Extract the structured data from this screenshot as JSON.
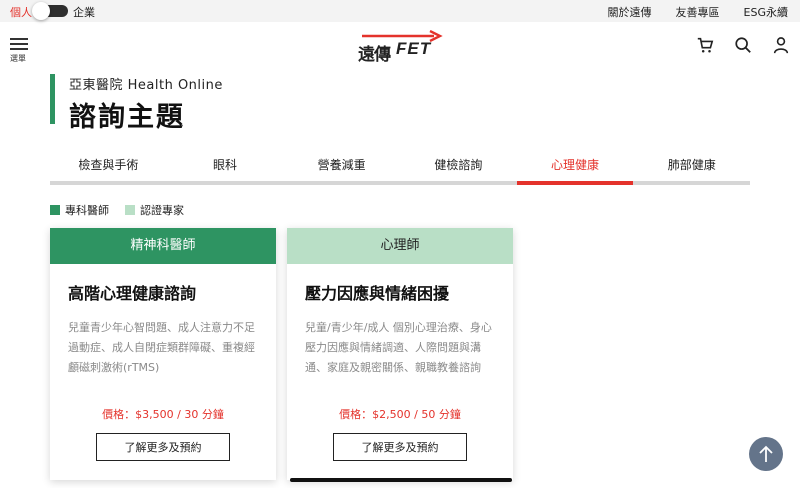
{
  "topbar": {
    "persona_personal": "個人",
    "persona_business": "企業",
    "links": [
      "關於遠傳",
      "友善專區",
      "ESG永續"
    ]
  },
  "header": {
    "menu_label": "選單",
    "logo_chinese": "遠傳",
    "logo_latin": "FET",
    "icons": [
      "cart-icon",
      "search-icon",
      "user-icon"
    ]
  },
  "section": {
    "subtitle": "亞東醫院 Health Online",
    "title": "諮詢主題"
  },
  "tabs": [
    {
      "label": "檢查與手術",
      "active": false
    },
    {
      "label": "眼科",
      "active": false
    },
    {
      "label": "營養減重",
      "active": false
    },
    {
      "label": "健檢諮詢",
      "active": false
    },
    {
      "label": "心理健康",
      "active": true
    },
    {
      "label": "肺部健康",
      "active": false
    }
  ],
  "legend": [
    {
      "label": "專科醫師",
      "color": "#2e9462"
    },
    {
      "label": "認證專家",
      "color": "#b9dfc6"
    }
  ],
  "cards": [
    {
      "category": "精神科醫師",
      "title": "高階心理健康諮詢",
      "description": "兒童青少年心智問題、成人注意力不足過動症、成人自閉症類群障礙、重複經顱磁刺激術(rTMS)",
      "price": "價格：$3,500 / 30 分鐘",
      "button": "了解更多及預約"
    },
    {
      "category": "心理師",
      "title": "壓力因應與情緒困擾",
      "description": "兒童/青少年/成人 個別心理治療、身心壓力因應與情緒調適、人際問題與溝通、家庭及親密關係、親職教養諮詢",
      "price": "價格：$2,500 / 50 分鐘",
      "button": "了解更多及預約"
    }
  ],
  "colors": {
    "accent_red": "#e4322b",
    "doctor_green": "#2e9462",
    "expert_green": "#b9dfc6"
  }
}
